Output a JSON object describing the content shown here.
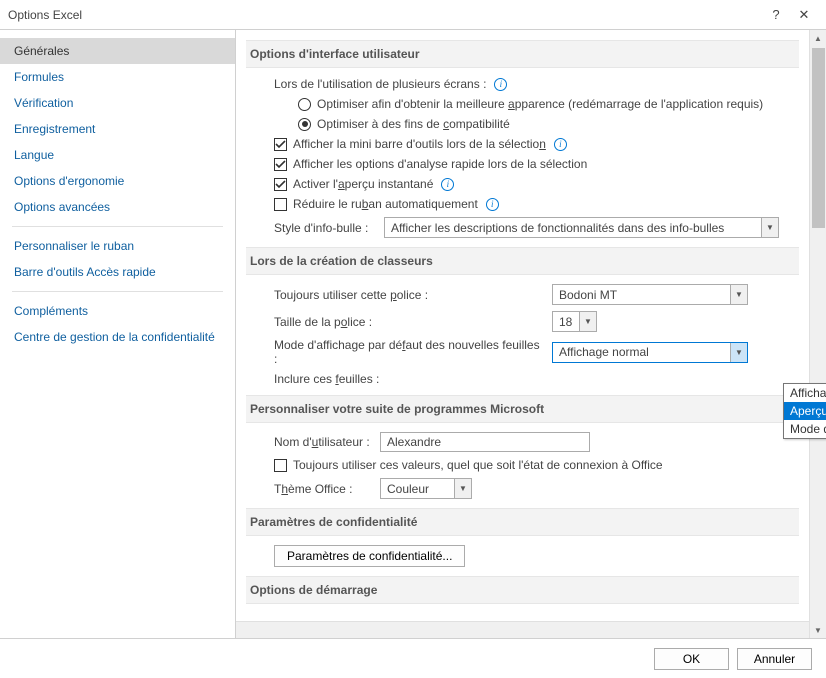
{
  "window": {
    "title": "Options Excel"
  },
  "sidebar": {
    "items": [
      "Générales",
      "Formules",
      "Vérification",
      "Enregistrement",
      "Langue",
      "Options d'ergonomie",
      "Options avancées"
    ],
    "items2": [
      "Personnaliser le ruban",
      "Barre d'outils Accès rapide"
    ],
    "items3": [
      "Compléments",
      "Centre de gestion de la confidentialité"
    ]
  },
  "ui": {
    "section_ui": "Options d'interface utilisateur",
    "multi_screen_label": "Lors de l'utilisation de plusieurs écrans :",
    "radio_optimize_appearance_pre": "Optimiser afin d'obtenir la meilleure ",
    "radio_optimize_appearance_u": "a",
    "radio_optimize_appearance_post": "pparence (redémarrage de l'application requis)",
    "radio_optimize_compat_pre": "Optimiser à des fins de ",
    "radio_optimize_compat_u": "c",
    "radio_optimize_compat_post": "ompatibilité",
    "chk_minibar_pre": "Afficher la mini barre d'outils lors de la sélectio",
    "chk_minibar_u": "n",
    "chk_analyse": "Afficher les options d'analyse rapide lors de la sélection",
    "chk_apercu_pre": "Activer l'",
    "chk_apercu_u": "a",
    "chk_apercu_post": "perçu instantané",
    "chk_ruban_pre": "Réduire le ru",
    "chk_ruban_u": "b",
    "chk_ruban_post": "an automatiquement",
    "tooltip_style_label": "Style d'info-bulle :",
    "tooltip_style_value": "Afficher les descriptions de fonctionnalités dans des info-bulles"
  },
  "workbook": {
    "section": "Lors de la création de classeurs",
    "font_label_pre": "Toujours utiliser cette ",
    "font_label_u": "p",
    "font_label_post": "olice :",
    "font_value": "Bodoni MT",
    "size_label_pre": "Taille de la p",
    "size_label_u": "o",
    "size_label_post": "lice :",
    "size_value": "18",
    "view_label_pre": "Mode d'affichage par dé",
    "view_label_u": "f",
    "view_label_post": "aut des nouvelles feuilles :",
    "view_value": "Affichage normal",
    "include_label_pre": "Inclure ces ",
    "include_label_u": "f",
    "include_label_post": "euilles :",
    "dropdown_opts": [
      "Affichage normal",
      "Aperçu des sauts de page",
      "Mode d'affichage Mise en page"
    ]
  },
  "personalize": {
    "section": "Personnaliser votre suite de programmes Microsoft",
    "username_label_pre": "Nom d'",
    "username_label_u": "u",
    "username_label_post": "tilisateur :",
    "username_value": "Alexandre",
    "always_label": "Toujours utiliser ces valeurs, quel que soit l'état de connexion à Office",
    "theme_label_pre": "T",
    "theme_label_u": "h",
    "theme_label_post": "ème Office :",
    "theme_value": "Couleur"
  },
  "privacy": {
    "section": "Paramètres de confidentialité",
    "button": "Paramètres de confidentialité..."
  },
  "startup": {
    "section": "Options de démarrage"
  },
  "footer": {
    "ok": "OK",
    "cancel": "Annuler"
  }
}
